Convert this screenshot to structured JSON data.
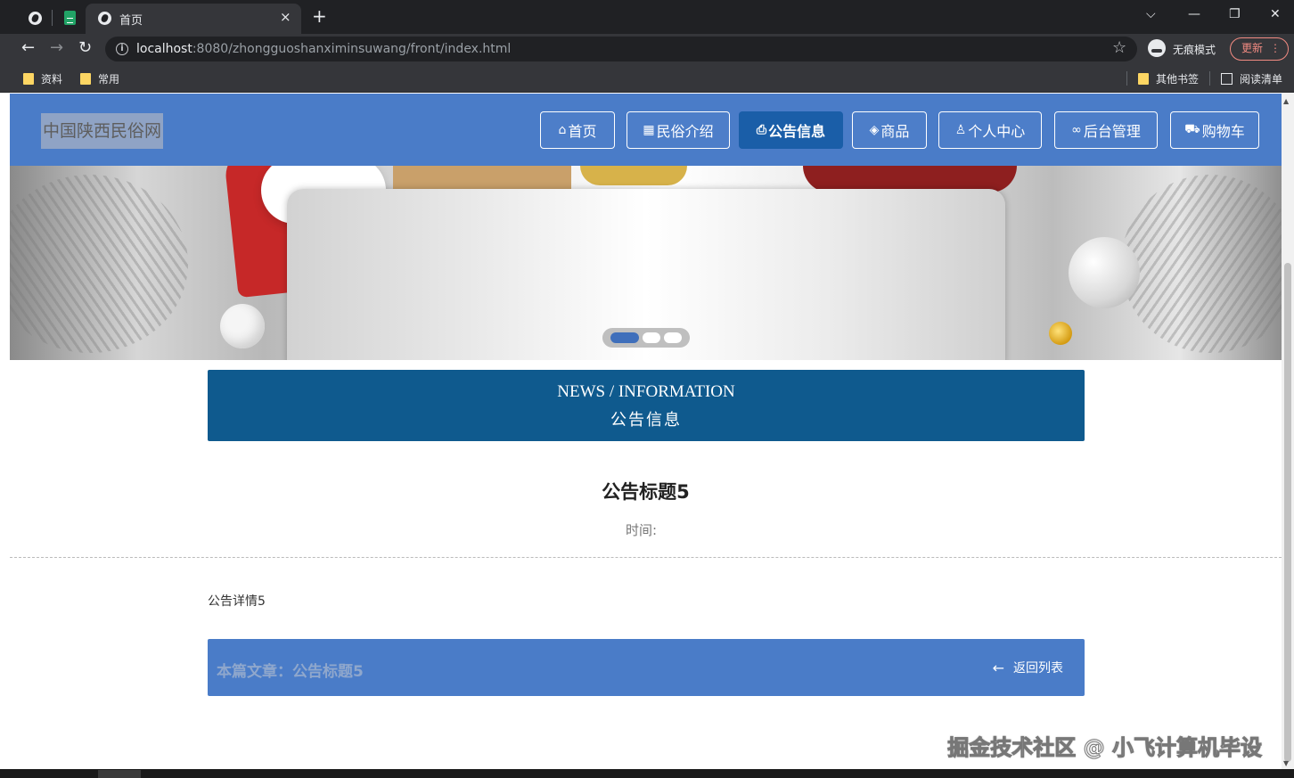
{
  "browser": {
    "tab_title": "首页",
    "tab_close": "×",
    "new_tab": "+",
    "window_controls": {
      "dropdown": "⌵",
      "minimize": "—",
      "restore": "❐",
      "close": "✕"
    },
    "url_host": "localhost",
    "url_rest": ":8080/zhongguoshanximinsuwang/front/index.html",
    "incognito_label": "无痕模式",
    "update_label": "更新",
    "bookmarks": [
      {
        "label": "资料"
      },
      {
        "label": "常用"
      }
    ],
    "other_bookmarks": "其他书签",
    "reading_list": "阅读清单"
  },
  "site": {
    "logo": "中国陕西民俗网",
    "nav": [
      {
        "label": "首页",
        "icon": "home-icon",
        "glyph": "⌂"
      },
      {
        "label": "民俗介绍",
        "icon": "calendar-icon",
        "glyph": "▦"
      },
      {
        "label": "公告信息",
        "icon": "print-icon",
        "glyph": "⎙",
        "active": true
      },
      {
        "label": "商品",
        "icon": "goods-icon",
        "glyph": "◈"
      },
      {
        "label": "个人中心",
        "icon": "user-icon",
        "glyph": "♙"
      },
      {
        "label": "后台管理",
        "icon": "link-icon",
        "glyph": "∞"
      },
      {
        "label": "购物车",
        "icon": "cart-icon",
        "glyph": "⛟"
      }
    ]
  },
  "carousel": {
    "slide_count": 3,
    "active_index": 0
  },
  "section": {
    "title_en": "NEWS / INFORMATION",
    "title_cn": "公告信息"
  },
  "article": {
    "title": "公告标题5",
    "time_label": "时间:",
    "body": "公告详情5"
  },
  "footer": {
    "current_label": "本篇文章：公告标题5",
    "back_label": "返回列表"
  },
  "watermark": "掘金技术社区 @ 小飞计算机毕设",
  "colors": {
    "header_bg": "#4a7cc8",
    "nav_active_bg": "#1a5ea8",
    "section_bg": "#0f5a8e",
    "footer_bg": "#4a7cc8"
  }
}
